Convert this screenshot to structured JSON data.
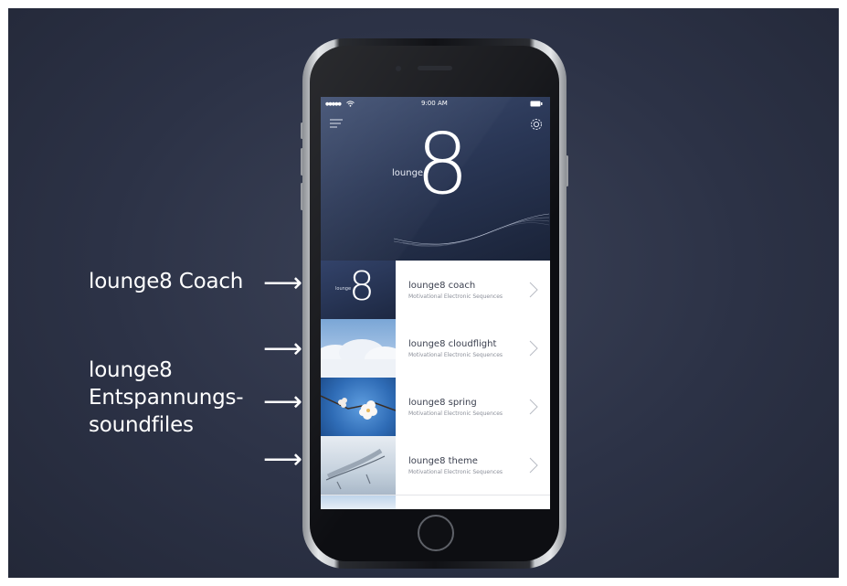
{
  "annotations": {
    "coach_label": "lounge8  Coach",
    "soundfiles_label_line1": "lounge8",
    "soundfiles_label_line2": "Entspannungs-",
    "soundfiles_label_line3": "soundfiles",
    "arrow_glyph": "⟶"
  },
  "status_bar": {
    "signal": "●●●●●",
    "wifi_icon": "wifi-icon",
    "time": "9:00 AM",
    "battery_icon": "battery-icon"
  },
  "header": {
    "menu_icon": "menu-icon",
    "settings_icon": "gear-icon",
    "logo_word": "lounge",
    "logo_numeral": "8"
  },
  "list": {
    "items": [
      {
        "title": "lounge8 coach",
        "subtitle": "Motivational Electronic Sequences",
        "thumb_word": "lounge",
        "thumb_numeral": "8"
      },
      {
        "title": "lounge8 cloudflight",
        "subtitle": "Motivational Electronic Sequences"
      },
      {
        "title": "lounge8 spring",
        "subtitle": "Motivational Electronic Sequences"
      },
      {
        "title": "lounge8 theme",
        "subtitle": "Motivational Electronic Sequences"
      }
    ]
  },
  "colors": {
    "backdrop": "#2c3246",
    "hero": "#2a3756",
    "list_text": "#3a3f4e",
    "subtitle_text": "#8b8f99"
  }
}
